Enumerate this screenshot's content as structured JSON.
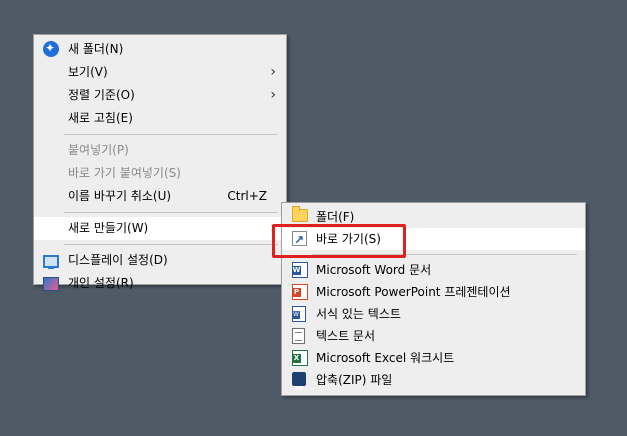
{
  "main_menu": {
    "items": [
      {
        "label": "새 폴더(N)",
        "icon": "new-folder-icon"
      },
      {
        "label": "보기(V)",
        "submenu": true
      },
      {
        "label": "정렬 기준(O)",
        "submenu": true
      },
      {
        "label": "새로 고침(E)"
      },
      {
        "label": "붙여넣기(P)",
        "disabled": true
      },
      {
        "label": "바로 가기 붙여넣기(S)",
        "disabled": true
      },
      {
        "label": "이름 바꾸기 취소(U)",
        "shortcut": "Ctrl+Z"
      },
      {
        "label": "새로 만들기(W)",
        "submenu": true,
        "highlighted": true
      },
      {
        "label": "디스플레이 설정(D)",
        "icon": "display-icon"
      },
      {
        "label": "개인 설정(R)",
        "icon": "personalize-icon"
      }
    ],
    "arrow_glyph": "›"
  },
  "sub_menu": {
    "items": [
      {
        "label": "폴더(F)",
        "icon": "folder-icon"
      },
      {
        "label": "바로 가기(S)",
        "icon": "shortcut-icon",
        "highlighted": true
      },
      {
        "label": "Microsoft Word 문서",
        "icon": "word-icon"
      },
      {
        "label": "Microsoft PowerPoint 프레젠테이션",
        "icon": "powerpoint-icon"
      },
      {
        "label": "서식 있는 텍스트",
        "icon": "rich-text-icon"
      },
      {
        "label": "텍스트 문서",
        "icon": "text-document-icon"
      },
      {
        "label": "Microsoft Excel 워크시트",
        "icon": "excel-icon"
      },
      {
        "label": "압축(ZIP) 파일",
        "icon": "zip-icon"
      }
    ]
  },
  "colors": {
    "desktop": "#4f5a67",
    "menu_bg": "#eeeeee",
    "highlight_box": "#e0201c"
  }
}
